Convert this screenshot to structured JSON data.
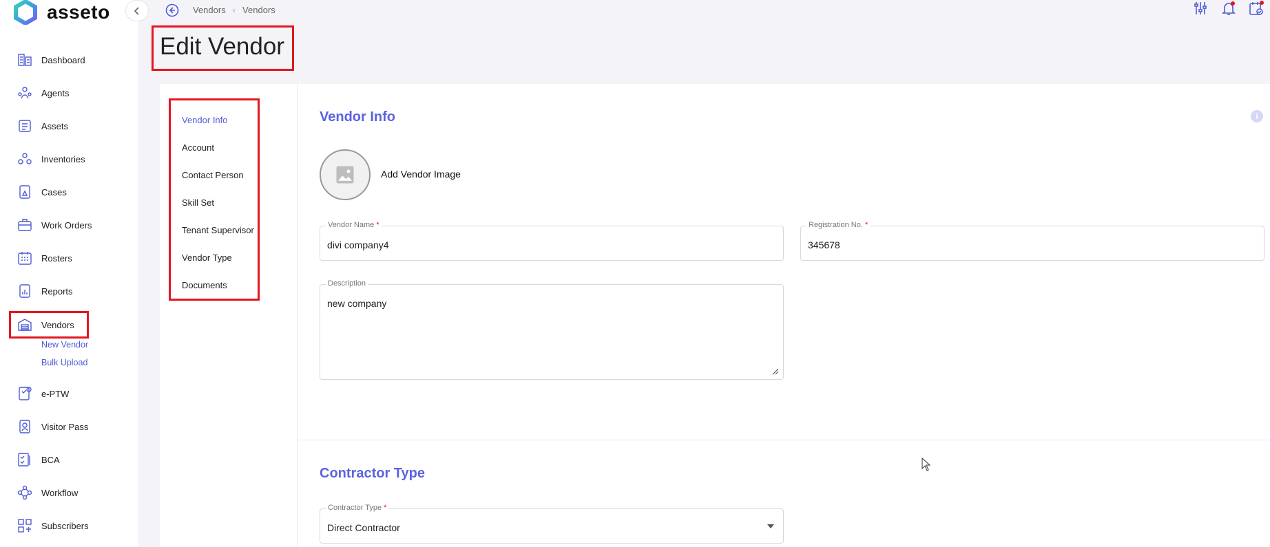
{
  "app": {
    "brand": "asseto"
  },
  "breadcrumb": [
    "Vendors",
    "Vendors"
  ],
  "page": {
    "title": "Edit Vendor"
  },
  "sidebar": {
    "items": [
      {
        "label": "Dashboard",
        "icon": "dashboard-icon"
      },
      {
        "label": "Agents",
        "icon": "agents-icon"
      },
      {
        "label": "Assets",
        "icon": "assets-icon"
      },
      {
        "label": "Inventories",
        "icon": "inventories-icon"
      },
      {
        "label": "Cases",
        "icon": "cases-icon"
      },
      {
        "label": "Work Orders",
        "icon": "work-orders-icon"
      },
      {
        "label": "Rosters",
        "icon": "rosters-icon"
      },
      {
        "label": "Reports",
        "icon": "reports-icon"
      },
      {
        "label": "Vendors",
        "icon": "vendors-icon"
      },
      {
        "label": "e-PTW",
        "icon": "eptw-icon"
      },
      {
        "label": "Visitor Pass",
        "icon": "visitor-pass-icon"
      },
      {
        "label": "BCA",
        "icon": "bca-icon"
      },
      {
        "label": "Workflow",
        "icon": "workflow-icon"
      },
      {
        "label": "Subscribers",
        "icon": "subscribers-icon"
      }
    ],
    "vendor_subitems": [
      "New Vendor",
      "Bulk Upload"
    ]
  },
  "subnav": {
    "items": [
      "Vendor Info",
      "Account",
      "Contact Person",
      "Skill Set",
      "Tenant Supervisor",
      "Vendor Type",
      "Documents"
    ],
    "active": "Vendor Info"
  },
  "vendor_info": {
    "title": "Vendor Info",
    "add_image_label": "Add Vendor Image",
    "vendor_name": {
      "label": "Vendor Name",
      "required_mark": "*",
      "value": "divi company4"
    },
    "registration_no": {
      "label": "Registration No.",
      "required_mark": "*",
      "value": "345678"
    },
    "description": {
      "label": "Description",
      "value": "new company"
    }
  },
  "contractor_type": {
    "title": "Contractor Type",
    "field": {
      "label": "Contractor Type",
      "required_mark": "*",
      "value": "Direct Contractor"
    }
  },
  "colors": {
    "accent": "#5a63e0",
    "highlight": "#e3161f",
    "link": "#4f5bd5"
  }
}
